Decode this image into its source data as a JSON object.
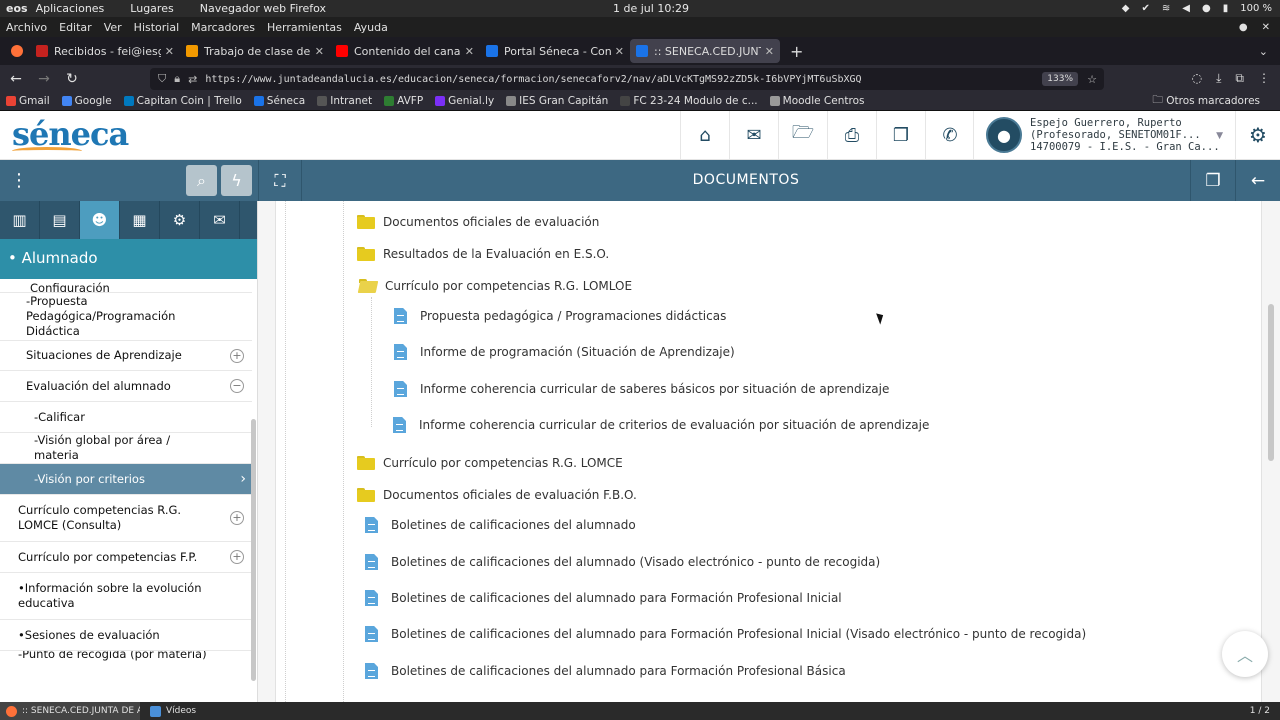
{
  "os": {
    "logo": "eos",
    "menu": [
      "Aplicaciones",
      "Lugares",
      "Navegador web Firefox"
    ],
    "clock": "1 de jul  10:29",
    "battery": "100 %"
  },
  "firefox_menu": [
    "Archivo",
    "Editar",
    "Ver",
    "Historial",
    "Marcadores",
    "Herramientas",
    "Ayuda"
  ],
  "tabs": [
    {
      "label": "Recibidos - fei@iesgranca",
      "color": "#c5221f"
    },
    {
      "label": "Trabajo de clase de SÉNECA",
      "color": "#f29900"
    },
    {
      "label": "Contenido del canal - YouTube",
      "color": "#ff0000"
    },
    {
      "label": "Portal Séneca - Consejería",
      "color": "#1a73e8"
    },
    {
      "label": ":: SENECA.CED.JUNTA DE ANDAL",
      "color": "#1a73e8"
    }
  ],
  "url": "https://www.juntadeandalucia.es/educacion/seneca/formacion/senecaforv2/nav/aDLVcKTgMS92zZD5k-I6bVPYjMT6uSbXGQ",
  "zoom": "133%",
  "bookmarks": [
    {
      "label": "Gmail",
      "color": "#ea4335"
    },
    {
      "label": "Google",
      "color": "#4285f4"
    },
    {
      "label": "Capitan Coin | Trello",
      "color": "#0079bf"
    },
    {
      "label": "Séneca",
      "color": "#1a73e8"
    },
    {
      "label": "Intranet",
      "color": "#555"
    },
    {
      "label": "AVFP",
      "color": "#2e7d32"
    },
    {
      "label": "Genial.ly",
      "color": "#7b2ff7"
    },
    {
      "label": "IES Gran Capitán",
      "color": "#888"
    },
    {
      "label": "FC 23-24 Modulo de c...",
      "color": "#444"
    },
    {
      "label": "Moodle Centros",
      "color": "#999"
    }
  ],
  "bookmarks_other": "Otros marcadores",
  "app": {
    "logo": "séneca",
    "user_lines": [
      "Espejo Guerrero, Ruperto",
      "(Profesorado, SENETOM01F...",
      "14700079 - I.E.S. - Gran Ca..."
    ],
    "page_title": "DOCUMENTOS",
    "section_title": "• Alumnado"
  },
  "sidebar": {
    "items": [
      {
        "text": "Configuración",
        "indent": 30,
        "height": 14,
        "top_clip": true
      },
      {
        "text": "-Propuesta Pedagógica/Programación Didáctica",
        "indent": 26,
        "height": 48
      },
      {
        "text": "Situaciones de Aprendizaje",
        "indent": 26,
        "height": 30,
        "plus": "+"
      },
      {
        "text": "Evaluación del alumnado",
        "indent": 26,
        "height": 31,
        "plus": "−"
      },
      {
        "text": "-Calificar",
        "indent": 34,
        "height": 31
      },
      {
        "text": "-Visión global por área / materia",
        "indent": 34,
        "height": 31
      },
      {
        "text": "-Visión por criterios",
        "indent": 34,
        "height": 31,
        "active": true
      },
      {
        "text": "Currículo competencias R.G. LOMCE (Consulta)",
        "indent": 18,
        "height": 47,
        "plus": "+"
      },
      {
        "text": "Currículo por competencias F.P.",
        "indent": 18,
        "height": 31,
        "plus": "+"
      },
      {
        "text": "•Información sobre la evolución educativa",
        "indent": 18,
        "height": 47
      },
      {
        "text": "•Sesiones de evaluación",
        "indent": 18,
        "height": 31
      },
      {
        "text": "-Punto de recogida (por materia)",
        "indent": 18,
        "height": 14,
        "bottom_clip": true
      }
    ]
  },
  "tree": [
    {
      "type": "folder",
      "label": "Documentos oficiales de evaluación"
    },
    {
      "type": "folder",
      "label": "Resultados de la Evaluación en E.S.O."
    },
    {
      "type": "folder-open",
      "label": "Currículo por competencias R.G. LOMLOE"
    },
    {
      "type": "doc",
      "label": "Propuesta pedagógica / Programaciones didácticas"
    },
    {
      "type": "doc",
      "label": "Informe de programación (Situación de Aprendizaje)"
    },
    {
      "type": "doc",
      "label": "Informe coherencia curricular de saberes básicos por situación de aprendizaje"
    },
    {
      "type": "doc",
      "label": "Informe coherencia curricular de criterios de evaluación por situación de aprendizaje"
    },
    {
      "type": "folder",
      "label": "Currículo por competencias R.G. LOMCE"
    },
    {
      "type": "folder",
      "label": "Documentos oficiales de evaluación F.B.O."
    },
    {
      "type": "doc",
      "label": "Boletines de calificaciones del alumnado"
    },
    {
      "type": "doc",
      "label": "Boletines de calificaciones del alumnado (Visado electrónico - punto de recogida)"
    },
    {
      "type": "doc",
      "label": "Boletines de calificaciones del alumnado para Formación Profesional Inicial"
    },
    {
      "type": "doc",
      "label": "Boletines de calificaciones del alumnado para Formación Profesional Inicial (Visado electrónico - punto de recogida)"
    },
    {
      "type": "doc",
      "label": "Boletines de calificaciones del alumnado para Formación Profesional Básica"
    }
  ],
  "taskbar": {
    "items": [
      ":: SENECA.CED.JUNTA DE ANDALUCIA",
      "Vídeos"
    ],
    "page": "1 / 2"
  }
}
